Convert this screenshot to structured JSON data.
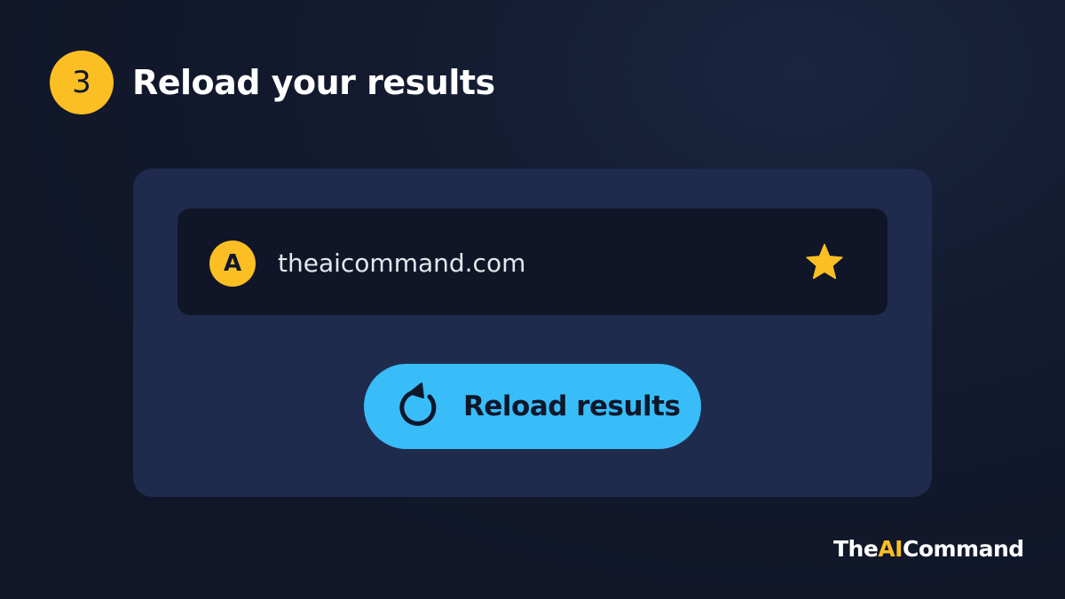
{
  "header": {
    "step_number": "3",
    "title": "Reload your results"
  },
  "address_bar": {
    "site_initial": "A",
    "url": "theaicommand.com",
    "bookmark_icon": "star-icon"
  },
  "reload_button": {
    "label": "Reload results",
    "icon": "reload-icon"
  },
  "brand": {
    "part1": "The",
    "part2": "AI",
    "part3": "Command"
  },
  "colors": {
    "accent_yellow": "#fbbf24",
    "button_blue": "#38bdf8",
    "card_bg": "#1f2b4d",
    "address_bar_bg": "#101628",
    "page_bg": "#131a2e"
  }
}
